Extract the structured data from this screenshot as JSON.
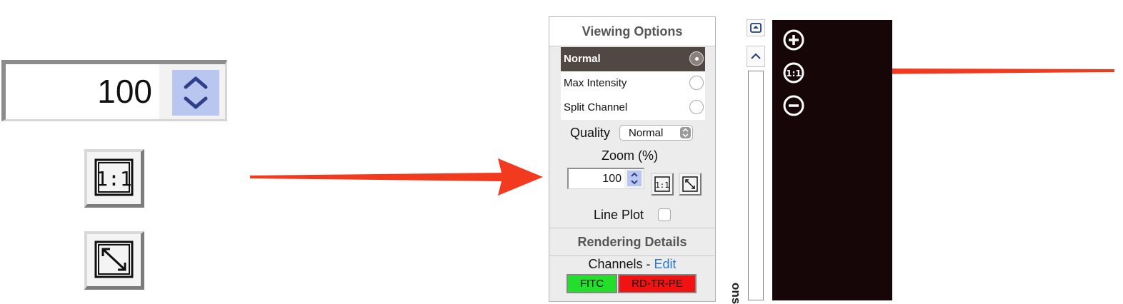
{
  "zoom_callout": {
    "value": "100",
    "one_to_one_icon": "one-to-one-icon",
    "fit_icon": "fit-to-window-icon"
  },
  "viewing_options": {
    "title": "Viewing Options",
    "modes": [
      {
        "label": "Normal",
        "selected": true
      },
      {
        "label": "Max Intensity",
        "selected": false
      },
      {
        "label": "Split Channel",
        "selected": false
      }
    ],
    "quality_label": "Quality",
    "quality_value": "Normal",
    "zoom_label": "Zoom (%)",
    "zoom_value": "100",
    "line_plot_label": "Line Plot"
  },
  "rendering_details": {
    "title": "Rendering Details",
    "channels_label": "Channels - ",
    "edit_link": "Edit",
    "channels": [
      {
        "name": "FITC",
        "color": "#22e02a"
      },
      {
        "name": "RD-TR-PE",
        "color": "#f21212"
      }
    ]
  },
  "side_strip": {
    "rotated_text": "ons"
  },
  "viewer_controls": {
    "zoom_in_icon": "zoom-in-icon",
    "actual_size_icon": "one-to-one-icon",
    "zoom_out_icon": "zoom-out-icon"
  },
  "colors": {
    "arrow": "#f23a1f",
    "viewer_bg": "#160608",
    "selected_row": "#514844",
    "spinner": "#b9c6f0",
    "link": "#2a78c8"
  }
}
